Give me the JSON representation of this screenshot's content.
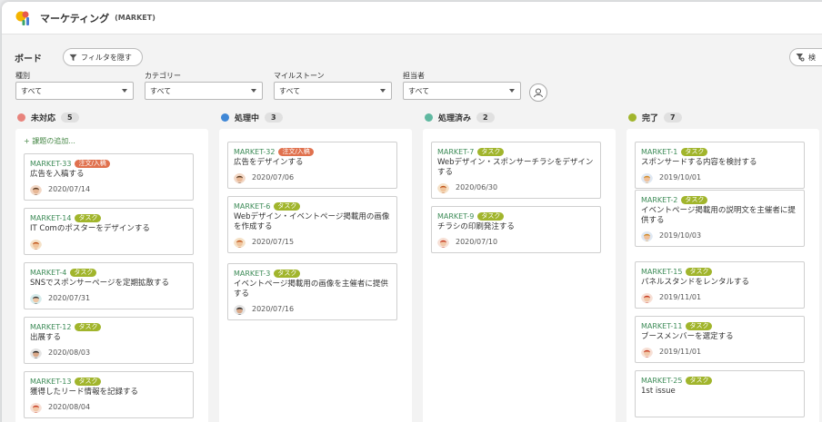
{
  "project": {
    "name": "マーケティング",
    "key": "(MARKET)"
  },
  "board": {
    "title": "ボード",
    "filter_button": "フィルタを隠す",
    "search_button": "検"
  },
  "filters": [
    {
      "label": "種別",
      "value": "すべて"
    },
    {
      "label": "カテゴリー",
      "value": "すべて"
    },
    {
      "label": "マイルストーン",
      "value": "すべて"
    },
    {
      "label": "担当者",
      "value": "すべて"
    }
  ],
  "columns": [
    {
      "name": "未対応",
      "count": "5",
      "color": "#e8837c",
      "add_label": "+ 課題の追加...",
      "cards": [
        {
          "key": "MARKET-33",
          "tag": "注文/入稿",
          "tag_type": "order",
          "title": "広告を入稿する",
          "date": "2020/07/14",
          "avatar": "man-brown"
        },
        {
          "key": "MARKET-14",
          "tag": "タスク",
          "tag_type": "task",
          "title": "IT Comのポスターをデザインする",
          "date": "",
          "avatar": "woman-orange"
        },
        {
          "key": "MARKET-4",
          "tag": "タスク",
          "tag_type": "task",
          "title": "SNSでスポンサーページを定期拡散する",
          "date": "2020/07/31",
          "avatar": "woman-teal"
        },
        {
          "key": "MARKET-12",
          "tag": "タスク",
          "tag_type": "task",
          "title": "出展する",
          "date": "2020/08/03",
          "avatar": "man-dark"
        },
        {
          "key": "MARKET-13",
          "tag": "タスク",
          "tag_type": "task",
          "title": "獲得したリード情報を記録する",
          "date": "2020/08/04",
          "avatar": "woman-red"
        }
      ]
    },
    {
      "name": "処理中",
      "count": "3",
      "color": "#3f87d6",
      "cards": [
        {
          "key": "MARKET-32",
          "tag": "注文/入稿",
          "tag_type": "order",
          "title": "広告をデザインする",
          "date": "2020/07/06",
          "avatar": "man-brown"
        },
        {
          "key": "MARKET-6",
          "tag": "タスク",
          "tag_type": "task",
          "title": "Webデザイン・イベントページ掲載用の画像を作成する",
          "date": "2020/07/15",
          "avatar": "woman-orange"
        },
        {
          "key": "MARKET-3",
          "tag": "タスク",
          "tag_type": "task",
          "title": "イベントページ掲載用の画像を主催者に提供する",
          "date": "2020/07/16",
          "avatar": "man-dark"
        }
      ]
    },
    {
      "name": "処理済み",
      "count": "2",
      "color": "#5fb8a0",
      "cards": [
        {
          "key": "MARKET-7",
          "tag": "タスク",
          "tag_type": "task",
          "title": "Webデザイン・スポンサーチラシをデザインする",
          "date": "2020/06/30",
          "avatar": "woman-orange"
        },
        {
          "key": "MARKET-9",
          "tag": "タスク",
          "tag_type": "task",
          "title": "チラシの印刷発注する",
          "date": "2020/07/10",
          "avatar": "woman-red"
        }
      ]
    },
    {
      "name": "完了",
      "count": "7",
      "color": "#a1b52c",
      "cards": [
        {
          "key": "MARKET-1",
          "tag": "タスク",
          "tag_type": "task",
          "title": "スポンサードする内容を検討する",
          "date": "2019/10/01",
          "avatar": "man-blue"
        },
        {
          "key": "MARKET-2",
          "tag": "タスク",
          "tag_type": "task",
          "title": "イベントページ掲載用の説明文を主催者に提供する",
          "date": "2019/10/03",
          "avatar": "man-blue"
        },
        {
          "key": "MARKET-15",
          "tag": "タスク",
          "tag_type": "task",
          "title": "パネルスタンドをレンタルする",
          "date": "2019/11/01",
          "avatar": "woman-red"
        },
        {
          "key": "MARKET-11",
          "tag": "タスク",
          "tag_type": "task",
          "title": "ブースメンバーを選定する",
          "date": "2019/11/01",
          "avatar": "woman-red"
        },
        {
          "key": "MARKET-25",
          "tag": "タスク",
          "tag_type": "task",
          "title": "1st issue",
          "date": "",
          "avatar": ""
        }
      ]
    }
  ]
}
